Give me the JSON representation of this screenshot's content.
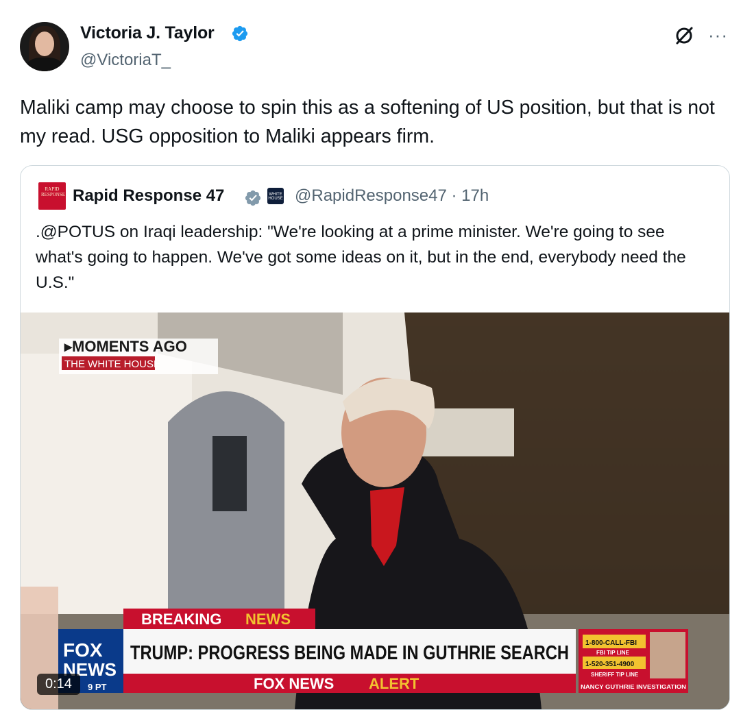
{
  "tweet": {
    "author_name": "Victoria J. Taylor",
    "author_handle": "@VictoriaT_",
    "text": "Maliki camp may choose to spin this as a softening of US position, but that is not my read. USG opposition to Maliki appears firm.",
    "more_label": "···"
  },
  "quoted": {
    "author_name": "Rapid Response 47",
    "avatar_text": "RAPID RESPONSE",
    "org_badge_text": "WHITE HOUSE",
    "handle_time": "@RapidResponse47 · 17h",
    "text": ".@POTUS on Iraqi leadership: \"We're looking at a prime minister. We're going to see what's going to happen. We've got some ideas on it, but in the end, everybody need the U.S.\""
  },
  "video": {
    "duration": "0:14",
    "tv": {
      "moments": "MOMENTS AGO",
      "location": "THE WHITE HOUSE",
      "breaking_1": "BREAKING",
      "breaking_2": "NEWS",
      "headline": "TRUMP: PROGRESS BEING MADE IN GUTHRIE SEARCH",
      "alert_1": "FOX NEWS",
      "alert_2": "ALERT",
      "logo_1": "FOX",
      "logo_2": "NEWS",
      "logo_time": "9 PT",
      "phone_1": "1-800-CALL-FBI",
      "phone_1_sub": "FBI TIP LINE",
      "phone_2": "1-520-351-4900",
      "phone_2_sub": "SHERIFF TIP LINE",
      "investigation": "NANCY GUTHRIE INVESTIGATION"
    }
  },
  "colors": {
    "verified": "#1d9bf0",
    "text": "#0f1419",
    "muted": "#536471",
    "border": "#cfd9de",
    "fox_red": "#c8102e",
    "fox_blue": "#0a3a8a"
  }
}
